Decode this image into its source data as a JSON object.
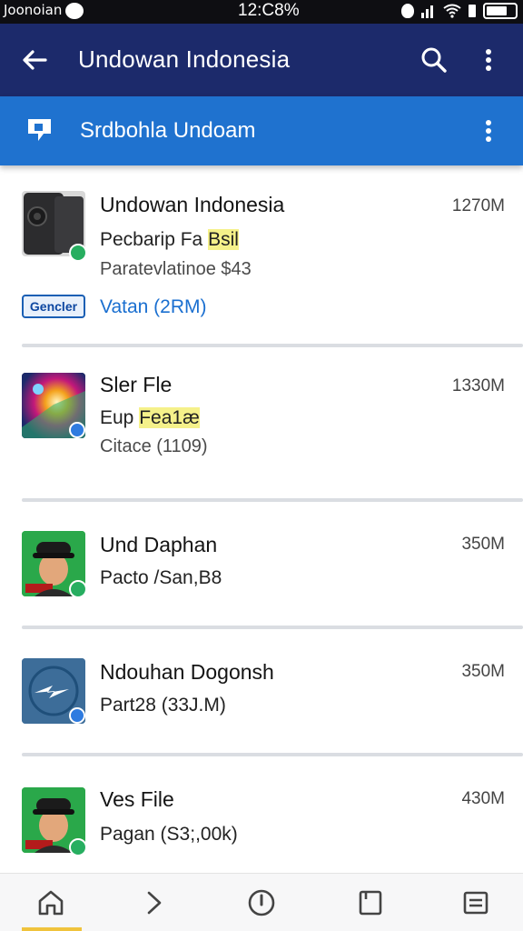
{
  "status": {
    "carrier": "Joonoian",
    "time": "12:C8%"
  },
  "app_bar": {
    "title": "Undowan Indonesia"
  },
  "sub_bar": {
    "title": "Srdbohla Undoam"
  },
  "items": [
    {
      "title": "Undowan Indonesia",
      "line2_prefix": "Pecbarip Fa ",
      "line2_highlight": "Bsil",
      "line3": "Paratevlatinoe $43",
      "size": "1270M",
      "tag": "Gencler",
      "link": "Vatan (2RM)"
    },
    {
      "title": "Sler Fle",
      "line2_prefix": "Eup ",
      "line2_highlight": "Fea1æ",
      "line3": "Citace (1109)",
      "size": "1330M"
    },
    {
      "title": "Und Daphan",
      "line2": "Pacto /San,B8",
      "size": "350M"
    },
    {
      "title": "Ndouhan Dogonsh",
      "line2": "Part28 (33J.M)",
      "size": "350M"
    },
    {
      "title": "Ves File",
      "line2": "Pagan (S3;,00k)",
      "size": "430M"
    }
  ],
  "icons": {
    "back": "arrow-left-icon",
    "search": "search-icon",
    "more": "more-vertical-icon",
    "sub": "chat-icon",
    "nav": [
      "home-icon",
      "chevron-right-icon",
      "compass-icon",
      "bookmark-icon",
      "menu-list-icon"
    ]
  },
  "colors": {
    "app_bar": "#1c2a6b",
    "sub_bar": "#1f72cf",
    "link": "#1a6fd0",
    "highlight": "#f5f18a"
  }
}
